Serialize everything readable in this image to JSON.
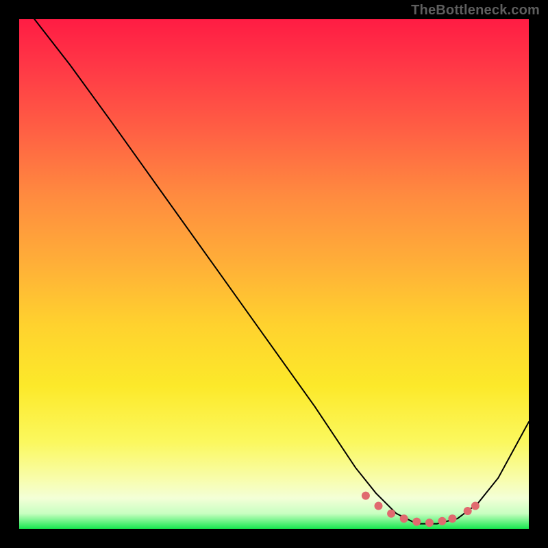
{
  "watermark": "TheBottleneck.com",
  "chart_data": {
    "type": "line",
    "title": "",
    "xlabel": "",
    "ylabel": "",
    "xlim": [
      0,
      100
    ],
    "ylim": [
      0,
      100
    ],
    "grid": false,
    "series": [
      {
        "name": "curve",
        "color": "#000000",
        "x": [
          3,
          10,
          18,
          28,
          38,
          48,
          58,
          66,
          70,
          74,
          78,
          82,
          86,
          90,
          94,
          100
        ],
        "y": [
          100,
          91,
          80,
          66,
          52,
          38,
          24,
          12,
          7,
          3,
          1,
          1,
          2,
          5,
          10,
          21
        ]
      }
    ],
    "markers": {
      "name": "optimal-zone",
      "color": "#e06a6f",
      "x": [
        68,
        70.5,
        73,
        75.5,
        78,
        80.5,
        83,
        85,
        88,
        89.5
      ],
      "y": [
        6.5,
        4.5,
        3,
        2,
        1.4,
        1.2,
        1.5,
        2,
        3.5,
        4.5
      ]
    }
  }
}
